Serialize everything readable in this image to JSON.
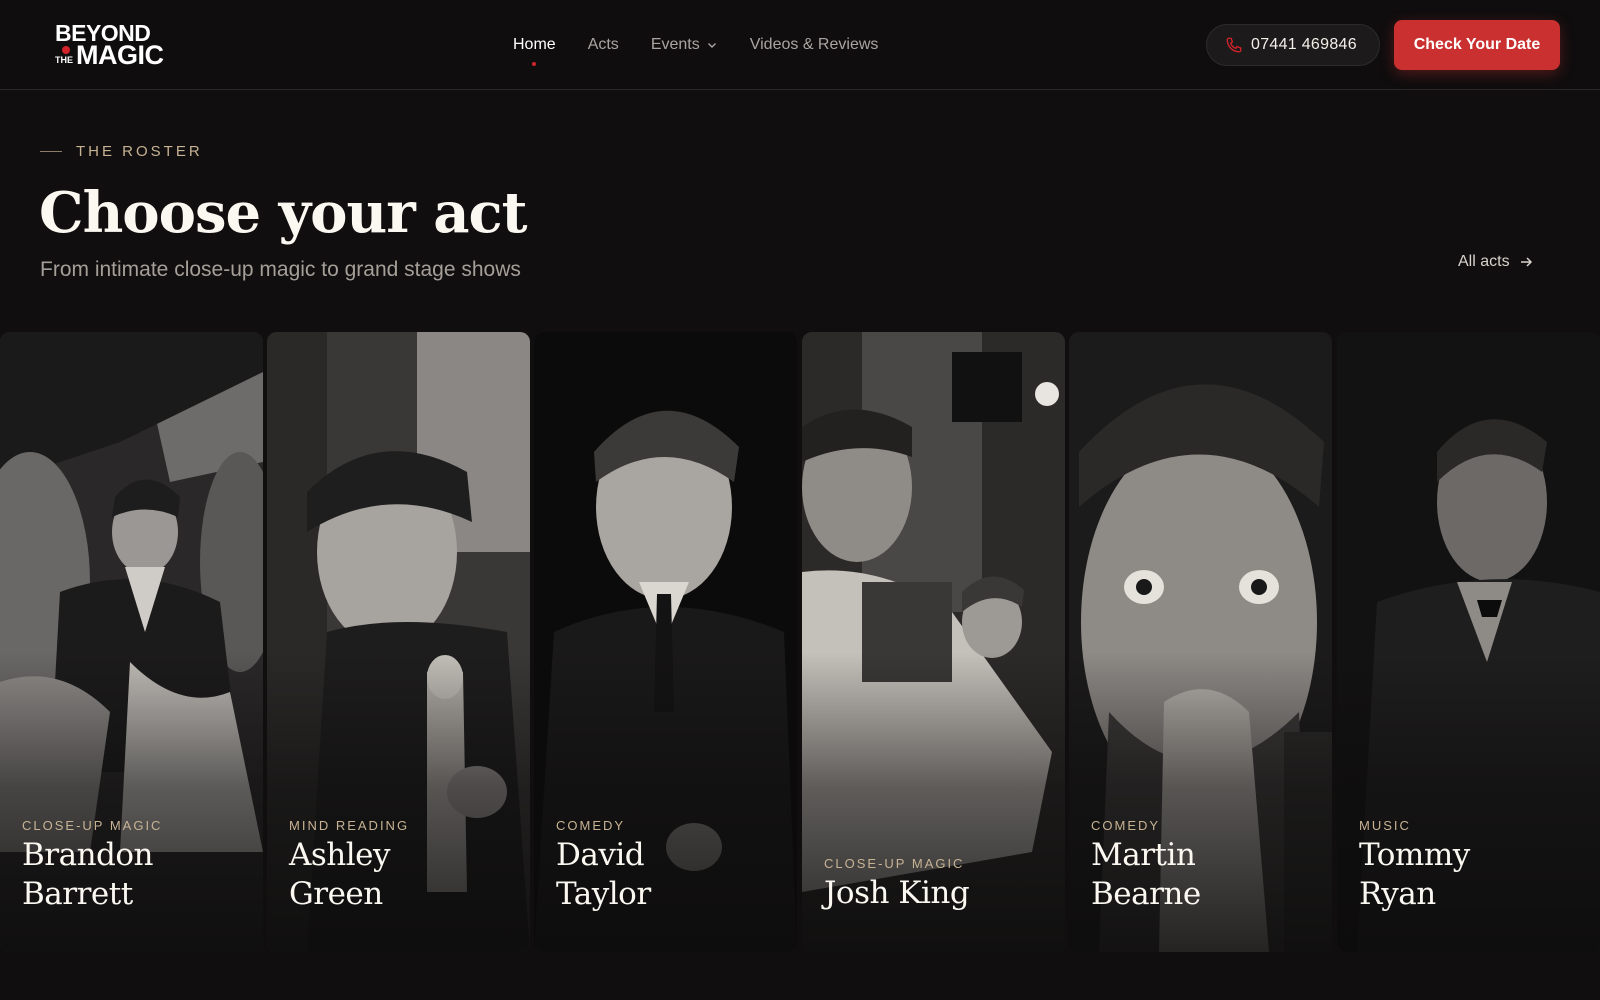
{
  "brand": {
    "line1": "BEYOND",
    "line2": "THE",
    "line3": "MAGIC"
  },
  "nav": {
    "items": [
      {
        "label": "Home",
        "active": true
      },
      {
        "label": "Acts"
      },
      {
        "label": "Events",
        "dropdown": true
      },
      {
        "label": "Videos & Reviews"
      }
    ]
  },
  "contact": {
    "phone": "07441 469846",
    "cta": "Check Your Date"
  },
  "section": {
    "eyebrow": "THE ROSTER",
    "title": "Choose your act",
    "subtitle": "From intimate close-up magic to grand stage shows",
    "link": "All acts"
  },
  "acts": [
    {
      "category": "CLOSE-UP MAGIC",
      "first": "Brandon",
      "last": "Barrett"
    },
    {
      "category": "MIND READING",
      "first": "Ashley",
      "last": "Green"
    },
    {
      "category": "COMEDY",
      "first": "David",
      "last": "Taylor"
    },
    {
      "category": "CLOSE-UP MAGIC",
      "first": "Josh King",
      "last": ""
    },
    {
      "category": "COMEDY",
      "first": "Martin",
      "last": "Bearne"
    },
    {
      "category": "MUSIC",
      "first": "Tommy",
      "last": "Ryan"
    }
  ],
  "colors": {
    "accent": "#c9302f",
    "gold": "#c7b394",
    "bg": "#100e0f"
  }
}
